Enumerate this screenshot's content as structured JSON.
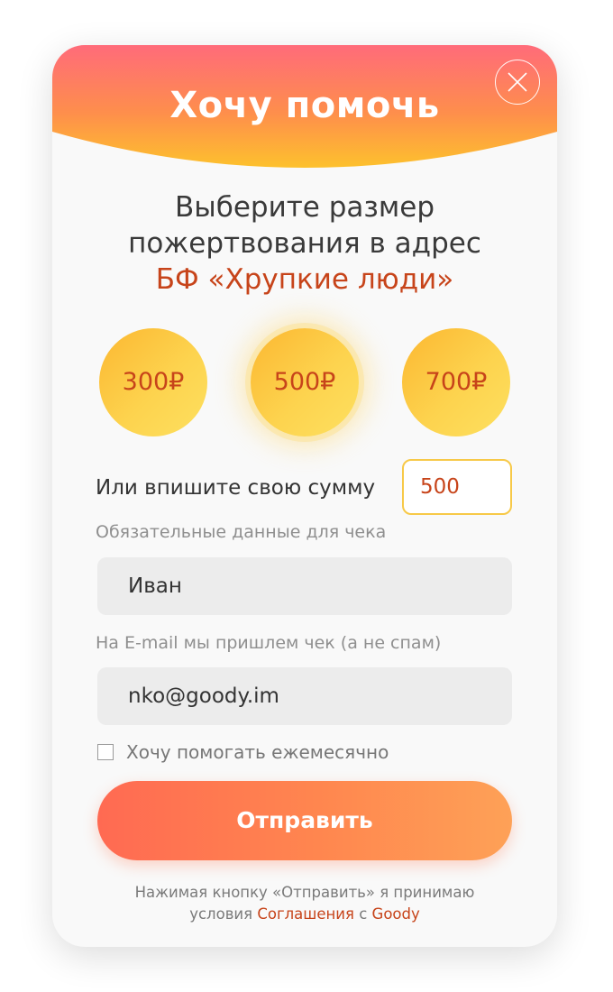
{
  "header": {
    "title": "Хочу помочь",
    "close_icon": "close-icon"
  },
  "intro": {
    "line1": "Выберите размер",
    "line2": "пожертвования в адрес",
    "org": "БФ «Хрупкие люди»"
  },
  "amounts": [
    {
      "label": "300₽",
      "selected": false
    },
    {
      "label": "500₽",
      "selected": true
    },
    {
      "label": "700₽",
      "selected": false
    }
  ],
  "custom_amount": {
    "label": "Или впишите свою сумму",
    "value": "500"
  },
  "receipt": {
    "hint": "Обязательные данные для чека",
    "name_value": "Иван",
    "email_hint": "На E-mail мы пришлем чек (а не спам)",
    "email_value": "nko@goody.im"
  },
  "monthly": {
    "label": "Хочу помогать ежемесячно",
    "checked": false
  },
  "submit": {
    "label": "Отправить"
  },
  "legal": {
    "line1": "Нажимая кнопку «Отправить» я принимаю",
    "prefix": "условия",
    "agreement_link": "Соглашения",
    "middle": "с",
    "brand_link": "Goody"
  },
  "colors": {
    "accent": "#c7441a",
    "header_top": "#ff6b7a",
    "header_bottom": "#fdc12d",
    "coin": "#fdd34e",
    "button_start": "#ff6a52",
    "button_end": "#fea157"
  }
}
